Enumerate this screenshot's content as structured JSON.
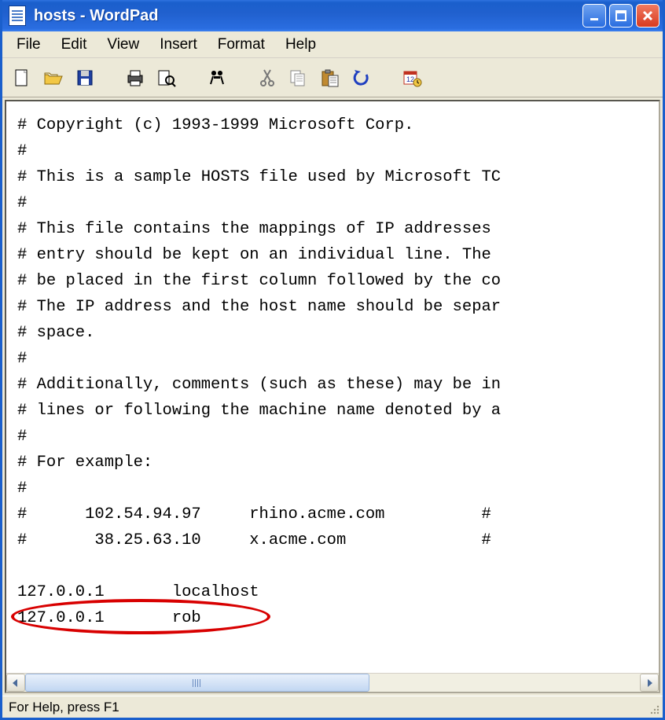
{
  "window": {
    "title": "hosts - WordPad"
  },
  "menu": {
    "items": [
      "File",
      "Edit",
      "View",
      "Insert",
      "Format",
      "Help"
    ]
  },
  "toolbar": {
    "buttons": [
      {
        "name": "new-icon"
      },
      {
        "name": "open-icon"
      },
      {
        "name": "save-icon"
      },
      {
        "sep": true
      },
      {
        "name": "print-icon"
      },
      {
        "name": "print-preview-icon"
      },
      {
        "sep": true
      },
      {
        "name": "find-icon"
      },
      {
        "sep": true
      },
      {
        "name": "cut-icon"
      },
      {
        "name": "copy-icon"
      },
      {
        "name": "paste-icon"
      },
      {
        "name": "undo-icon"
      },
      {
        "sep": true
      },
      {
        "name": "datetime-icon"
      }
    ]
  },
  "document": {
    "lines": [
      "# Copyright (c) 1993-1999 Microsoft Corp.",
      "#",
      "# This is a sample HOSTS file used by Microsoft TC",
      "#",
      "# This file contains the mappings of IP addresses ",
      "# entry should be kept on an individual line. The ",
      "# be placed in the first column followed by the co",
      "# The IP address and the host name should be separ",
      "# space.",
      "#",
      "# Additionally, comments (such as these) may be in",
      "# lines or following the machine name denoted by a",
      "#",
      "# For example:",
      "#",
      "#      102.54.94.97     rhino.acme.com          #",
      "#       38.25.63.10     x.acme.com              #",
      "",
      "127.0.0.1       localhost",
      "127.0.0.1       rob"
    ]
  },
  "status": {
    "text": "For Help, press F1"
  },
  "annotation": {
    "highlight_line_index": 19
  }
}
